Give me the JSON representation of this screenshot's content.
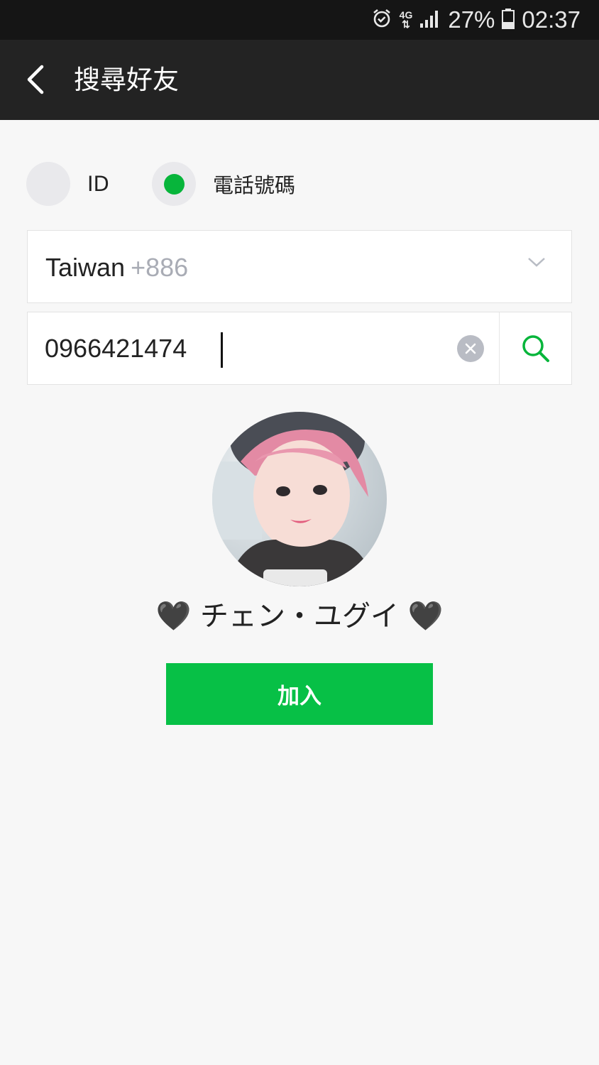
{
  "status_bar": {
    "network": [
      "4G",
      "⇅"
    ],
    "battery": "27%",
    "time": "02:37"
  },
  "header": {
    "title": "搜尋好友"
  },
  "search_type": {
    "options": [
      {
        "label": "ID",
        "selected": false
      },
      {
        "label": "電話號碼",
        "selected": true
      }
    ]
  },
  "country": {
    "name": "Taiwan",
    "code": "+886"
  },
  "phone_input": {
    "value": "0966421474"
  },
  "result": {
    "display_name": "🖤 チェン・ユグイ 🖤",
    "add_label": "加入"
  },
  "colors": {
    "accent": "#07c046",
    "header_bg": "#232323",
    "status_bg": "#151515"
  }
}
